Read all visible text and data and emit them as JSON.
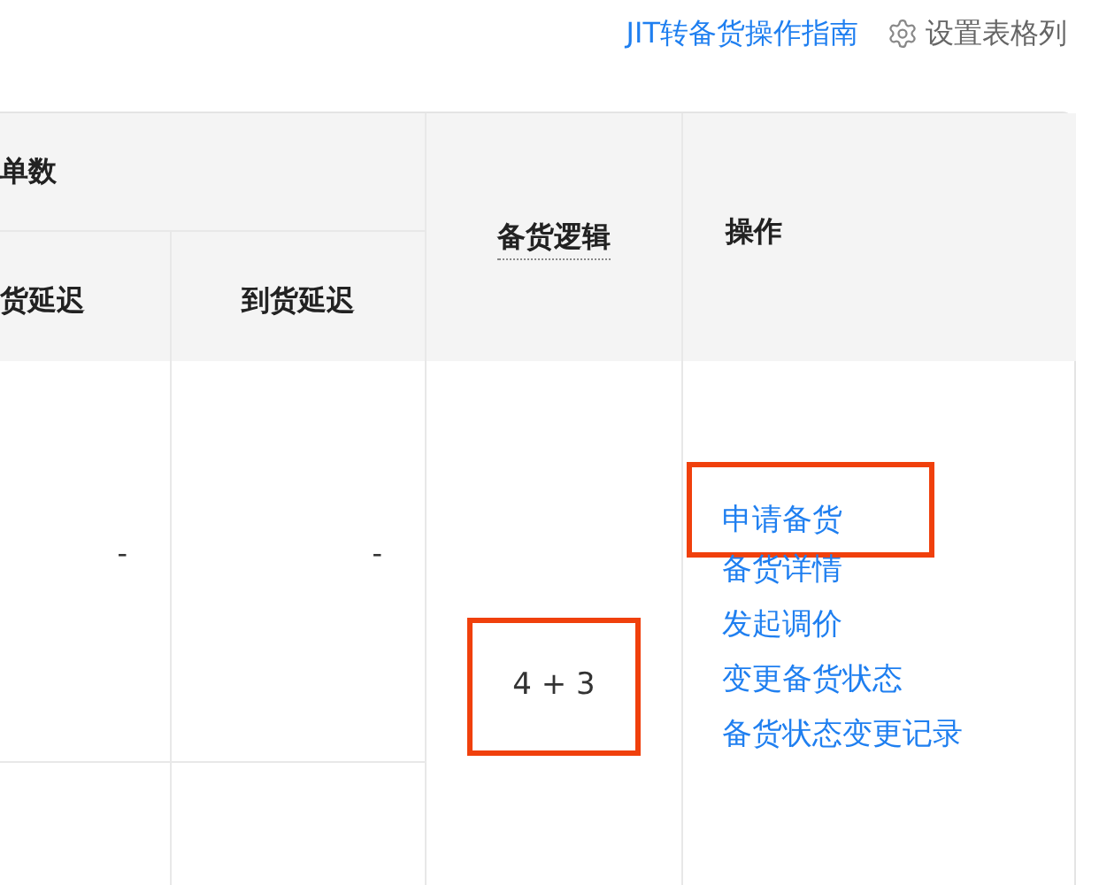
{
  "toolbar": {
    "guide_link": "JIT转备货操作指南",
    "settings_label": "设置表格列"
  },
  "table": {
    "group_header": "单数",
    "sub_columns": [
      "货延迟",
      "到货延迟"
    ],
    "logic_header": "备货逻辑",
    "actions_header": "操作",
    "row": {
      "cells": [
        "-",
        "-"
      ],
      "logic": "4 + 3",
      "logic_highlighted": true,
      "actions": [
        {
          "label": "申请备货",
          "highlighted": true
        },
        {
          "label": "备货详情",
          "highlighted": false
        },
        {
          "label": "发起调价",
          "highlighted": false
        },
        {
          "label": "变更备货状态",
          "highlighted": false
        },
        {
          "label": "备货状态变更记录",
          "highlighted": false
        }
      ]
    }
  }
}
